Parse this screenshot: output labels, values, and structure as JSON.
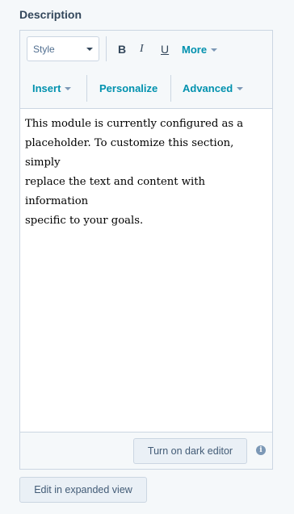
{
  "field": {
    "label": "Description"
  },
  "toolbar": {
    "style_select": "Style",
    "bold": "B",
    "italic": "I",
    "underline": "U",
    "more": "More",
    "insert": "Insert",
    "personalize": "Personalize",
    "advanced": "Advanced"
  },
  "content": {
    "lines": [
      "This module is currently configured as a",
      "placeholder. To customize this section, simply",
      "replace the text and content with information",
      "specific to your goals."
    ]
  },
  "footer": {
    "dark_editor": "Turn on dark editor",
    "info": "i"
  },
  "expand": "Edit in expanded view"
}
